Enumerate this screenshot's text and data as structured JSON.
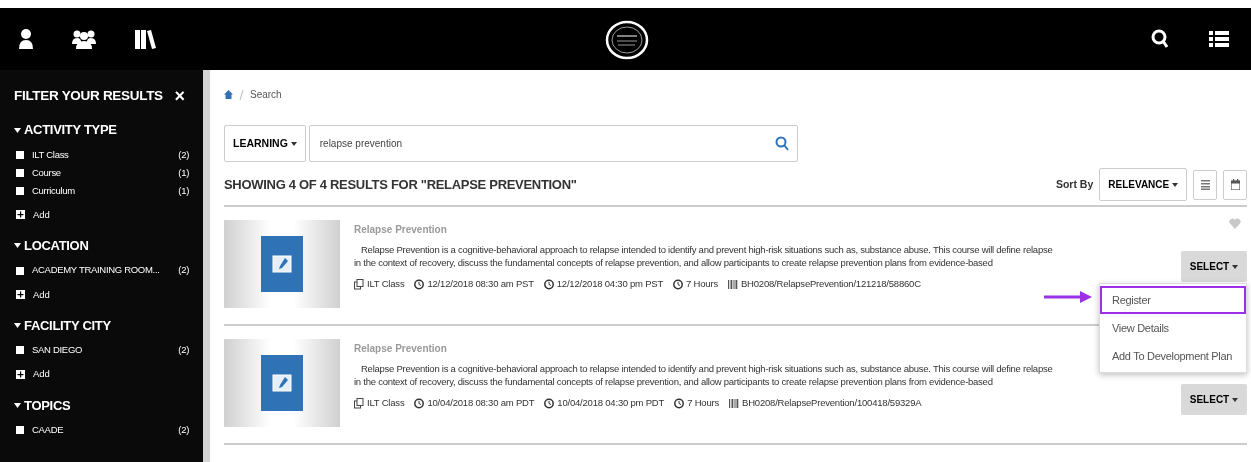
{
  "sidebar": {
    "title": "FILTER YOUR RESULTS",
    "close": "×",
    "groups": [
      {
        "title": "ACTIVITY TYPE",
        "expanded": true,
        "items": [
          {
            "label": "ILT Class",
            "count": "(2)",
            "checked": false
          },
          {
            "label": "Course",
            "count": "(1)",
            "checked": false
          },
          {
            "label": "Curriculum",
            "count": "(1)",
            "checked": false
          }
        ],
        "add": "Add"
      },
      {
        "title": "LOCATION",
        "expanded": true,
        "items": [
          {
            "label": "ACADEMY TRAINING ROOM...",
            "count": "(2)",
            "checked": false
          }
        ],
        "add": "Add"
      },
      {
        "title": "FACILITY CITY",
        "expanded": true,
        "items": [
          {
            "label": "SAN DIEGO",
            "count": "(2)",
            "checked": false
          }
        ],
        "add": "Add"
      },
      {
        "title": "TOPICS",
        "expanded": true,
        "items": [
          {
            "label": "CAADE",
            "count": "(2)",
            "checked": false
          }
        ]
      }
    ]
  },
  "breadcrumb": [
    "Search"
  ],
  "search": {
    "scope": "LEARNING",
    "value": "relapse prevention"
  },
  "results_heading": "SHOWING 4 OF 4 RESULTS FOR \"RELAPSE PREVENTION\"",
  "sort": {
    "label": "Sort By",
    "value": "RELEVANCE"
  },
  "results": [
    {
      "title": "Relapse Prevention",
      "description": "Relapse Prevention is a cognitive-behavioral approach to relapse intended to identify and prevent high-risk situations such as, substance abuse. This course will define relapse in the context of recovery, discuss the fundamental concepts of relapse prevention, and allow participants to create relapse prevention plans from evidence-based",
      "meta": [
        {
          "kind": "type",
          "text": "ILT Class"
        },
        {
          "kind": "time",
          "text": "12/12/2018 08:30 am PST"
        },
        {
          "kind": "time",
          "text": "12/12/2018 04:30 pm PST"
        },
        {
          "kind": "time",
          "text": "7 Hours"
        },
        {
          "kind": "code",
          "text": "BH0208/RelapsePrevention/121218/58860C"
        }
      ],
      "button": "SELECT",
      "favorite": true,
      "menu": [
        {
          "label": "Register",
          "selected": true
        },
        {
          "label": "View Details",
          "selected": false
        },
        {
          "label": "Add To Development Plan",
          "selected": false
        }
      ]
    },
    {
      "title": "Relapse Prevention",
      "description": "Relapse Prevention is a cognitive-behavioral approach to relapse intended to identify and prevent high-risk situations such as, substance abuse. This course will define relapse in the context of recovery, discuss the fundamental concepts of relapse prevention, and allow participants to create relapse prevention plans from evidence-based",
      "meta": [
        {
          "kind": "type",
          "text": "ILT Class"
        },
        {
          "kind": "time",
          "text": "10/04/2018 08:30 am PDT"
        },
        {
          "kind": "time",
          "text": "10/04/2018 04:30 pm PDT"
        },
        {
          "kind": "time",
          "text": "7 Hours"
        },
        {
          "kind": "code",
          "text": "BH0208/RelapsePrevention/100418/59329A"
        }
      ],
      "button": "SELECT"
    }
  ]
}
